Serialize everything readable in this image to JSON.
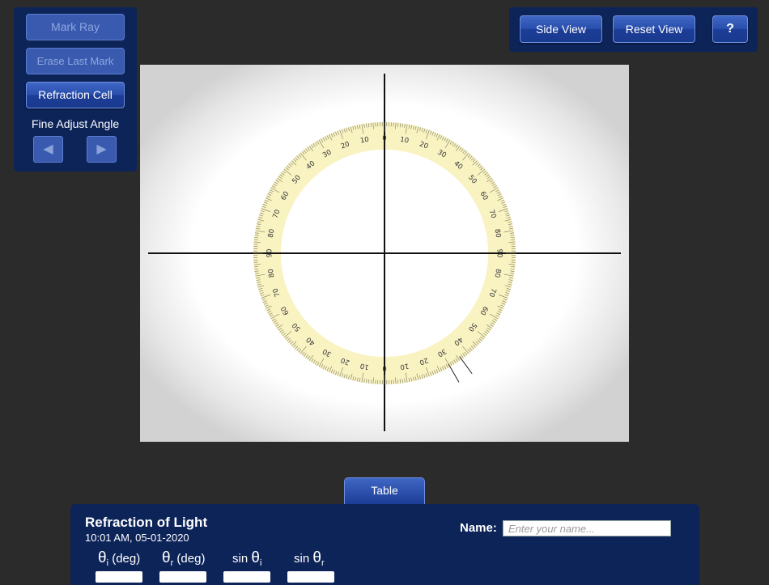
{
  "left_panel": {
    "mark_ray": "Mark Ray",
    "erase_last_mark": "Erase Last Mark",
    "refraction_cell": "Refraction Cell",
    "fine_adjust_label": "Fine Adjust Angle",
    "left_arrow": "◀",
    "right_arrow": "▶"
  },
  "top_panel": {
    "side_view": "Side View",
    "reset_view": "Reset View",
    "help": "?"
  },
  "protractor": {
    "labels": [
      "0",
      "10",
      "20",
      "30",
      "40",
      "50",
      "60",
      "70",
      "80",
      "90"
    ],
    "laser_mark_angles_deg": [
      30,
      36
    ]
  },
  "table": {
    "tab_label": "Table",
    "title": "Refraction of Light",
    "timestamp": "10:01 AM, 05-01-2020",
    "name_label": "Name:",
    "name_placeholder": "Enter your name...",
    "columns": [
      {
        "symbol": "θ",
        "sub": "i",
        "suffix": "(deg)"
      },
      {
        "symbol": "θ",
        "sub": "r",
        "suffix": "(deg)"
      },
      {
        "prefix": "sin",
        "symbol": "θ",
        "sub": "i"
      },
      {
        "prefix": "sin",
        "symbol": "θ",
        "sub": "r"
      }
    ]
  }
}
